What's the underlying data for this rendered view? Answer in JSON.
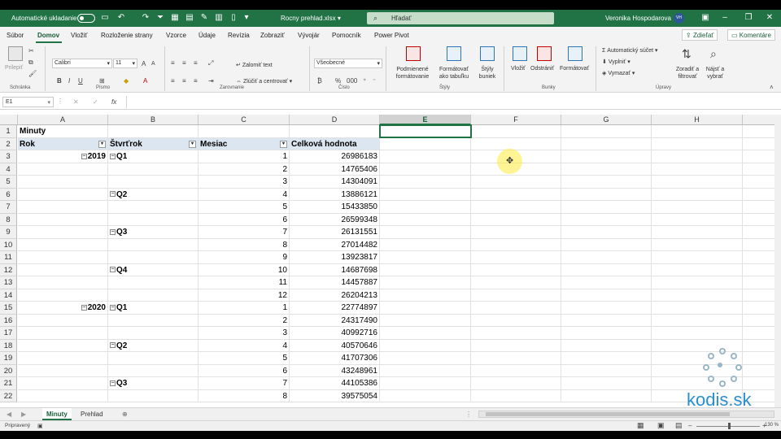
{
  "titlebar": {
    "autosave_label": "Automatické ukladanie",
    "doc_title": "Rocny prehlad.xlsx",
    "search_placeholder": "Hľadať",
    "user_name": "Veronika Hospodarova",
    "user_initials": "VH"
  },
  "tabs": [
    "Súbor",
    "Domov",
    "Vložiť",
    "Rozloženie strany",
    "Vzorce",
    "Údaje",
    "Revízia",
    "Zobraziť",
    "Vývojár",
    "Pomocník",
    "Power Pivot"
  ],
  "tab_actions": {
    "share": "Zdieľať",
    "comments": "Komentáre"
  },
  "ribbon": {
    "clipboard": {
      "paste": "Prilepiť",
      "group": "Schránka"
    },
    "font": {
      "name": "Calibri",
      "size": "11",
      "group": "Písmo"
    },
    "alignment": {
      "wrap": "Zalomiť text",
      "merge": "Zlúčiť a centrovať",
      "group": "Zarovnanie"
    },
    "number": {
      "format": "Všeobecné",
      "group": "Číslo"
    },
    "styles": {
      "conditional": "Podmienené formátovanie",
      "as_table": "Formátovať ako tabuľku",
      "cell_styles": "Štýly buniek",
      "group": "Štýly"
    },
    "cells": {
      "insert": "Vložiť",
      "delete": "Odstrániť",
      "format": "Formátovať",
      "group": "Bunky"
    },
    "editing": {
      "autosum": "Automatický súčet",
      "fill": "Vyplniť",
      "clear": "Vymazať",
      "sort": "Zoradiť a filtrovať",
      "find": "Nájsť a vybrať",
      "group": "Úpravy"
    }
  },
  "formula_bar": {
    "name_box": "E1",
    "formula": ""
  },
  "columns": [
    "A",
    "B",
    "C",
    "D",
    "E",
    "F",
    "G",
    "H"
  ],
  "selected_column": "E",
  "pivot": {
    "title": "Minuty",
    "headers": {
      "year": "Rok",
      "quarter": "Štvrťrok",
      "month": "Mesiac",
      "value": "Celková hodnota"
    },
    "rows": [
      {
        "row": "3",
        "year": "2019",
        "quarter": "Q1",
        "month": "1",
        "value": "26986183"
      },
      {
        "row": "4",
        "year": "",
        "quarter": "",
        "month": "2",
        "value": "14765406"
      },
      {
        "row": "5",
        "year": "",
        "quarter": "",
        "month": "3",
        "value": "14304091"
      },
      {
        "row": "6",
        "year": "",
        "quarter": "Q2",
        "month": "4",
        "value": "13886121"
      },
      {
        "row": "7",
        "year": "",
        "quarter": "",
        "month": "5",
        "value": "15433850"
      },
      {
        "row": "8",
        "year": "",
        "quarter": "",
        "month": "6",
        "value": "26599348"
      },
      {
        "row": "9",
        "year": "",
        "quarter": "Q3",
        "month": "7",
        "value": "26131551"
      },
      {
        "row": "10",
        "year": "",
        "quarter": "",
        "month": "8",
        "value": "27014482"
      },
      {
        "row": "11",
        "year": "",
        "quarter": "",
        "month": "9",
        "value": "13923817"
      },
      {
        "row": "12",
        "year": "",
        "quarter": "Q4",
        "month": "10",
        "value": "14687698"
      },
      {
        "row": "13",
        "year": "",
        "quarter": "",
        "month": "11",
        "value": "14457887"
      },
      {
        "row": "14",
        "year": "",
        "quarter": "",
        "month": "12",
        "value": "26204213"
      },
      {
        "row": "15",
        "year": "2020",
        "quarter": "Q1",
        "month": "1",
        "value": "22774897"
      },
      {
        "row": "16",
        "year": "",
        "quarter": "",
        "month": "2",
        "value": "24317490"
      },
      {
        "row": "17",
        "year": "",
        "quarter": "",
        "month": "3",
        "value": "40992716"
      },
      {
        "row": "18",
        "year": "",
        "quarter": "Q2",
        "month": "4",
        "value": "40570646"
      },
      {
        "row": "19",
        "year": "",
        "quarter": "",
        "month": "5",
        "value": "41707306"
      },
      {
        "row": "20",
        "year": "",
        "quarter": "",
        "month": "6",
        "value": "43248961"
      },
      {
        "row": "21",
        "year": "",
        "quarter": "Q3",
        "month": "7",
        "value": "44105386"
      },
      {
        "row": "22",
        "year": "",
        "quarter": "",
        "month": "8",
        "value": "39575054"
      }
    ]
  },
  "sheet_tabs": [
    "Minuty",
    "Prehlad"
  ],
  "active_sheet": "Minuty",
  "status": {
    "ready": "Pripravený",
    "zoom": "130 %"
  },
  "watermark": "kodis.sk",
  "colors": {
    "excel_green": "#217346",
    "pivot_header": "#dce6f1"
  }
}
